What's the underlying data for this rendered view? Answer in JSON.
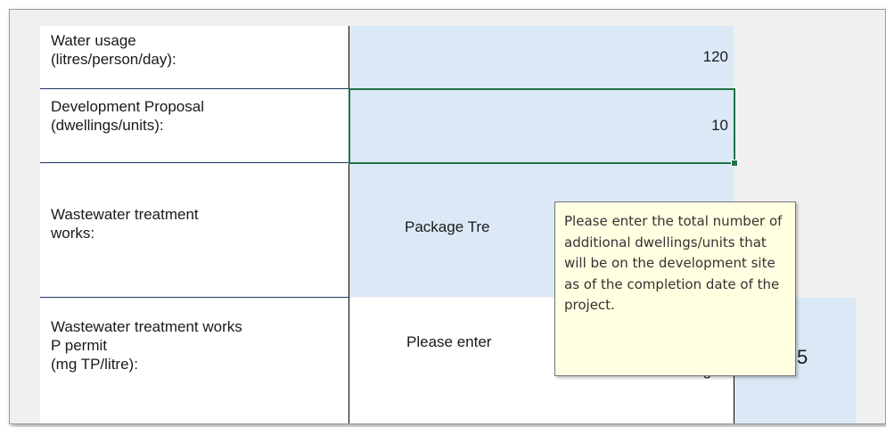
{
  "rows": [
    {
      "label": "Water usage\n(litres/person/day):",
      "value": "120"
    },
    {
      "label": "Development Proposal\n(dwellings/units):",
      "value": "10"
    },
    {
      "label": "Wastewater treatment\nworks:",
      "value": "Package Tre"
    },
    {
      "label": "Wastewater treatment works\nP permit\n(mg TP/litre):",
      "value": "Please enter",
      "value_tail": "right.",
      "side_glyph": "5"
    }
  ],
  "tooltip": "Please enter the total number of additional dwellings/units that will be on the development site as of the completion date of the project.",
  "colors": {
    "input_fill": "#dbe9f7",
    "selection_border": "#217346",
    "tooltip_bg": "#ffffe1",
    "row_border": "#1f3864"
  }
}
